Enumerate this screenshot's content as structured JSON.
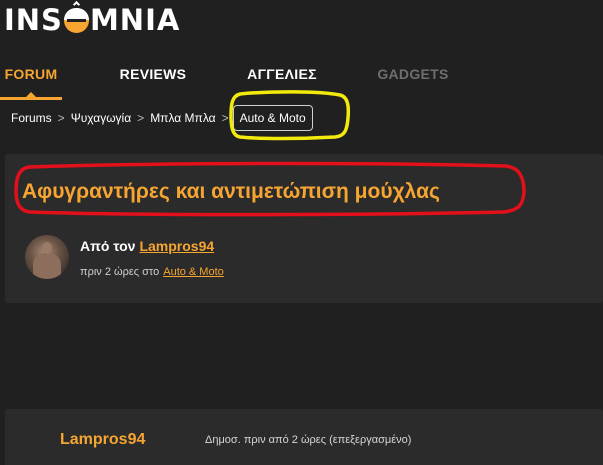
{
  "logo": {
    "text_left": "INS",
    "text_right": "MNIA",
    "brand_color": "#f7a531"
  },
  "nav": {
    "tabs": [
      {
        "label": "FORUM",
        "active": true
      },
      {
        "label": "REVIEWS",
        "active": false
      },
      {
        "label": "ΑΓΓΕΛΙΕΣ",
        "active": false
      },
      {
        "label": "GADGETS",
        "active": false
      }
    ]
  },
  "breadcrumb": {
    "items": [
      "Forums",
      "Ψυχαγωγία",
      "Μπλα Μπλα",
      "Auto & Moto"
    ],
    "separator": ">"
  },
  "thread": {
    "title": "Αφυγραντήρες και αντιμετώπιση μούχλας",
    "author_prefix": "Από τον",
    "author": "Lampros94",
    "meta_time": "πριν 2 ώρες στο",
    "meta_forum": "Auto & Moto"
  },
  "post": {
    "author": "Lampros94",
    "meta": "Δημοσ. πριν από 2 ώρες (επεξεργασμένο)"
  },
  "annotations": {
    "yellow_color": "#f2ea0c",
    "red_color": "#e3101c"
  }
}
